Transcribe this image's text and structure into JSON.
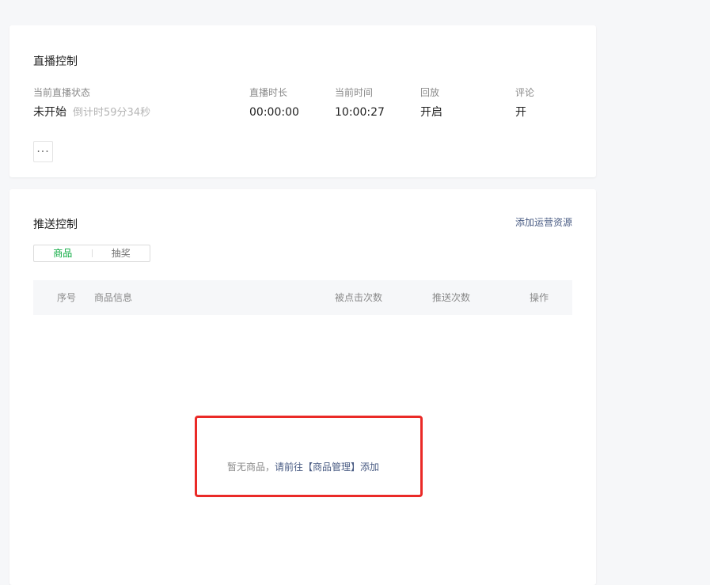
{
  "live_control": {
    "title": "直播控制",
    "stats": {
      "status": {
        "label": "当前直播状态",
        "value": "未开始",
        "countdown": "倒计时59分34秒"
      },
      "duration": {
        "label": "直播时长",
        "value": "00:00:00"
      },
      "current_time": {
        "label": "当前时间",
        "value": "10:00:27"
      },
      "replay": {
        "label": "回放",
        "value": "开启"
      },
      "comment": {
        "label": "评论",
        "value": "开"
      }
    },
    "more_button": "···"
  },
  "push_control": {
    "title": "推送控制",
    "add_link": "添加运营资源",
    "tabs": [
      {
        "label": "商品",
        "active": true
      },
      {
        "label": "抽奖",
        "active": false
      }
    ],
    "columns": [
      "序号",
      "商品信息",
      "被点击次数",
      "推送次数",
      "操作"
    ],
    "empty_text": "暂无商品，",
    "empty_link": "请前往【商品管理】添加"
  },
  "colors": {
    "accent_green": "#07a83c",
    "link_blue": "#4a5c84",
    "highlight_red": "#ea2a27"
  }
}
